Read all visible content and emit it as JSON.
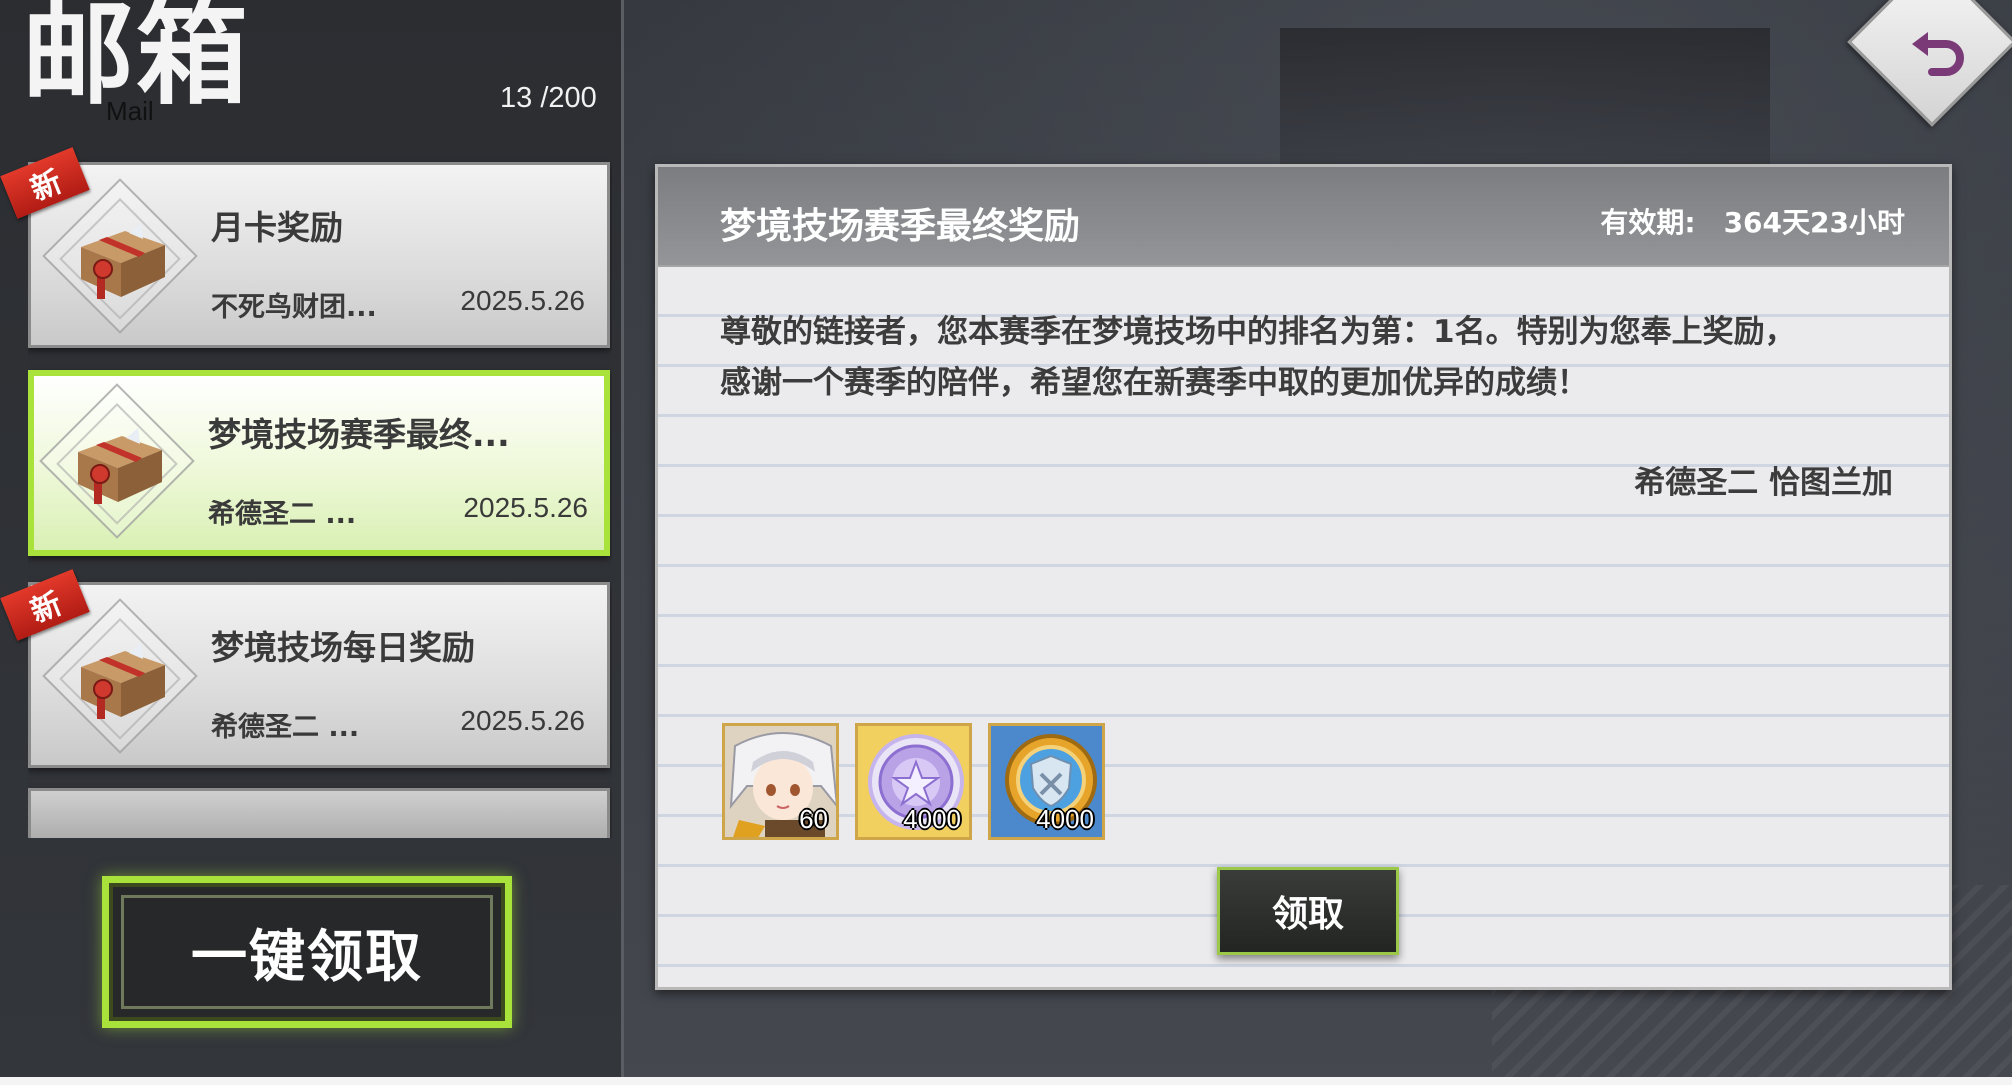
{
  "header": {
    "title": "邮箱",
    "subtitle": "Mail",
    "mail_count": "13 /200"
  },
  "mail_list": [
    {
      "title": "月卡奖励",
      "sender": "不死鸟财团...",
      "date": "2025.5.26",
      "is_new": true,
      "selected": false,
      "new_label": "新"
    },
    {
      "title": "梦境技场赛季最终...",
      "sender": "希德圣二 ...",
      "date": "2025.5.26",
      "is_new": false,
      "selected": true
    },
    {
      "title": "梦境技场每日奖励",
      "sender": "希德圣二 ...",
      "date": "2025.5.26",
      "is_new": true,
      "selected": false,
      "new_label": "新"
    }
  ],
  "claim_all_label": "一键领取",
  "detail": {
    "title": "梦境技场赛季最终奖励",
    "validity_label": "有效期:",
    "validity_value": "364天23小时",
    "body_line1": "尊敬的链接者，您本赛季在梦境技场中的排名为第：1名。特别为您奉上奖励，",
    "body_line2": "感谢一个赛季的陪伴，希望您在新赛季中取的更加优异的成绩！",
    "signature": "希德圣二 恰图兰加",
    "rewards": [
      {
        "icon": "character-portrait-icon",
        "quantity": "60"
      },
      {
        "icon": "purple-medal-icon",
        "quantity": "4000"
      },
      {
        "icon": "gold-shield-coin-icon",
        "quantity": "4000"
      }
    ],
    "claim_label": "领取"
  },
  "colors": {
    "accent_green": "#a8e23a",
    "new_badge_red": "#d12a1e",
    "panel_header_gray": "#85878a"
  }
}
